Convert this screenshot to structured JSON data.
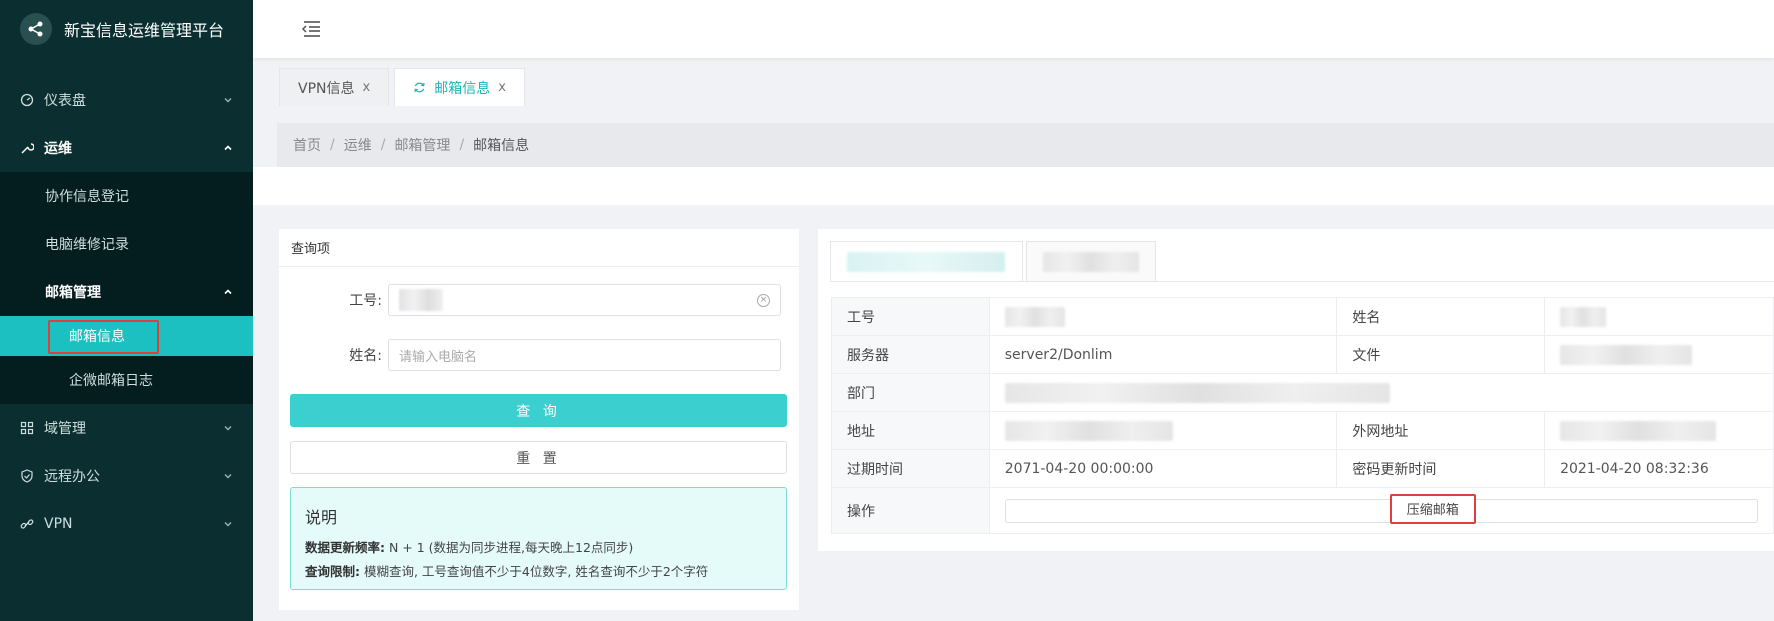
{
  "app": {
    "title": "新宝信息运维管理平台"
  },
  "sidebar": {
    "items": [
      {
        "label": "仪表盘",
        "icon": "dashboard-icon"
      },
      {
        "label": "运维",
        "icon": "wrench-icon"
      },
      {
        "label": "域管理",
        "icon": "grid-icon"
      },
      {
        "label": "远程办公",
        "icon": "shield-icon"
      },
      {
        "label": "VPN",
        "icon": "link-icon"
      }
    ],
    "ops_sub": {
      "item1": "协作信息登记",
      "item2": "电脑维修记录",
      "mail_mgmt": "邮箱管理",
      "mail_info": "邮箱信息",
      "wecom_log": "企微邮箱日志"
    }
  },
  "tabs": [
    {
      "label": "VPN信息",
      "close": "x"
    },
    {
      "label": "邮箱信息",
      "close": "x"
    }
  ],
  "breadcrumb": [
    "首页",
    "运维",
    "邮箱管理",
    "邮箱信息"
  ],
  "breadcrumb_sep": "/",
  "query": {
    "title": "查询项",
    "id_label": "工号:",
    "name_label": "姓名:",
    "name_placeholder": "请输入电脑名",
    "query_button": "查 询",
    "reset_button": "重 置",
    "note_title": "说明",
    "note_freq_label": "数据更新频率:",
    "note_freq_value": " N + 1 (数据为同步进程,每天晚上12点同步)",
    "note_limit_label": "查询限制:",
    "note_limit_value": " 模糊查询, 工号查询值不少于4位数字, 姓名查询不少于2个字符"
  },
  "detail": {
    "labels": {
      "id": "工号",
      "name": "姓名",
      "server": "服务器",
      "file": "文件",
      "dept": "部门",
      "address": "地址",
      "ext_address": "外网地址",
      "expire": "过期时间",
      "pwd_update": "密码更新时间",
      "operation": "操作"
    },
    "values": {
      "server": "server2/Donlim",
      "expire": "2071-04-20 00:00:00",
      "pwd_update": "2021-04-20 08:32:36"
    },
    "compress_button": "压缩邮箱"
  },
  "colors": {
    "sidebar_bg": "#0b2f30",
    "accent": "#1cc0c0",
    "highlight_box": "#e0403b"
  }
}
